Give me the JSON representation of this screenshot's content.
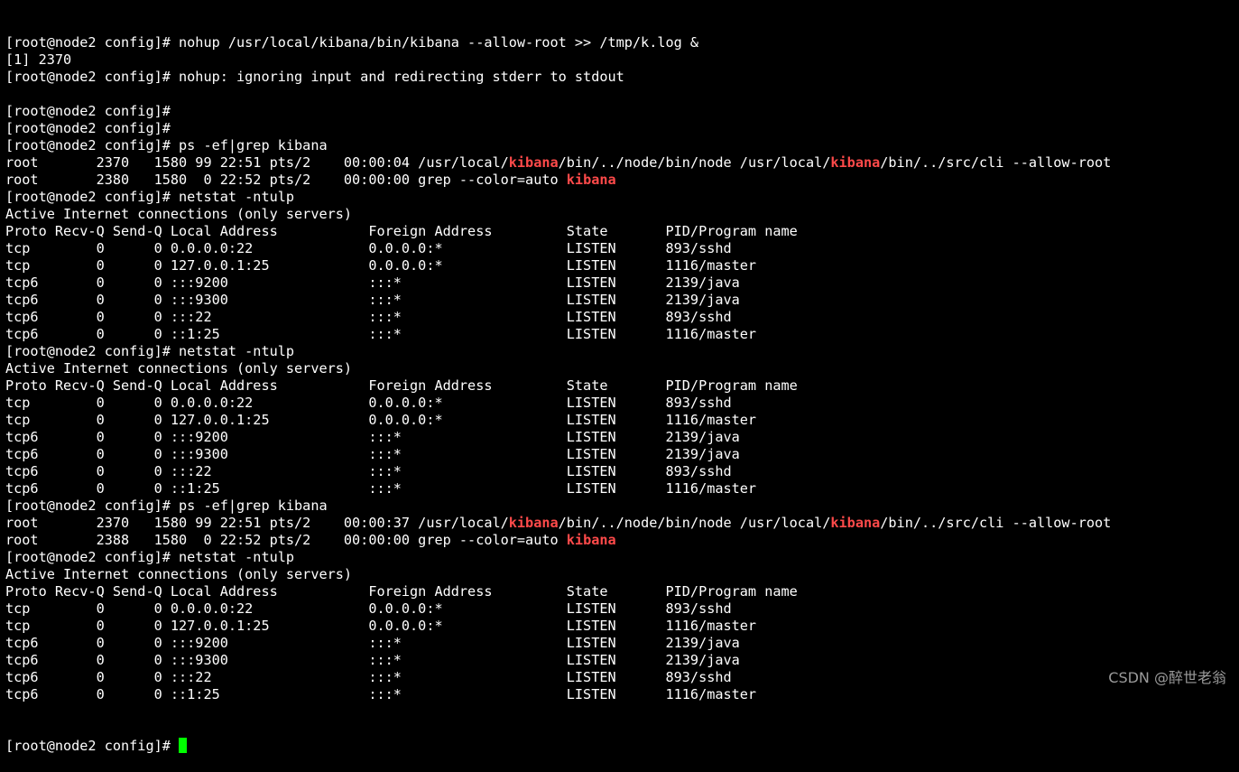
{
  "terminal": {
    "lines": [
      [
        {
          "t": "[root@node2 config]# nohup /usr/local/kibana/bin/kibana --allow-root >> /tmp/k.log &"
        }
      ],
      [
        {
          "t": "[1] 2370"
        }
      ],
      [
        {
          "t": "[root@node2 config]# nohup: ignoring input and redirecting stderr to stdout"
        }
      ],
      [
        {
          "t": ""
        }
      ],
      [
        {
          "t": "[root@node2 config]#"
        }
      ],
      [
        {
          "t": "[root@node2 config]#"
        }
      ],
      [
        {
          "t": "[root@node2 config]# ps -ef|grep kibana"
        }
      ],
      [
        {
          "t": "root       2370   1580 99 22:51 pts/2    00:00:04 /usr/local/"
        },
        {
          "t": "kibana",
          "hl": true
        },
        {
          "t": "/bin/../node/bin/node /usr/local/"
        },
        {
          "t": "kibana",
          "hl": true
        },
        {
          "t": "/bin/../src/cli --allow-root"
        }
      ],
      [
        {
          "t": "root       2380   1580  0 22:52 pts/2    00:00:00 grep --color=auto "
        },
        {
          "t": "kibana",
          "hl": true
        }
      ],
      [
        {
          "t": "[root@node2 config]# netstat -ntulp"
        }
      ],
      [
        {
          "t": "Active Internet connections (only servers)"
        }
      ],
      [
        {
          "t": "Proto Recv-Q Send-Q Local Address           Foreign Address         State       PID/Program name"
        }
      ],
      [
        {
          "t": "tcp        0      0 0.0.0.0:22              0.0.0.0:*               LISTEN      893/sshd"
        }
      ],
      [
        {
          "t": "tcp        0      0 127.0.0.1:25            0.0.0.0:*               LISTEN      1116/master"
        }
      ],
      [
        {
          "t": "tcp6       0      0 :::9200                 :::*                    LISTEN      2139/java"
        }
      ],
      [
        {
          "t": "tcp6       0      0 :::9300                 :::*                    LISTEN      2139/java"
        }
      ],
      [
        {
          "t": "tcp6       0      0 :::22                   :::*                    LISTEN      893/sshd"
        }
      ],
      [
        {
          "t": "tcp6       0      0 ::1:25                  :::*                    LISTEN      1116/master"
        }
      ],
      [
        {
          "t": "[root@node2 config]# netstat -ntulp"
        }
      ],
      [
        {
          "t": "Active Internet connections (only servers)"
        }
      ],
      [
        {
          "t": "Proto Recv-Q Send-Q Local Address           Foreign Address         State       PID/Program name"
        }
      ],
      [
        {
          "t": "tcp        0      0 0.0.0.0:22              0.0.0.0:*               LISTEN      893/sshd"
        }
      ],
      [
        {
          "t": "tcp        0      0 127.0.0.1:25            0.0.0.0:*               LISTEN      1116/master"
        }
      ],
      [
        {
          "t": "tcp6       0      0 :::9200                 :::*                    LISTEN      2139/java"
        }
      ],
      [
        {
          "t": "tcp6       0      0 :::9300                 :::*                    LISTEN      2139/java"
        }
      ],
      [
        {
          "t": "tcp6       0      0 :::22                   :::*                    LISTEN      893/sshd"
        }
      ],
      [
        {
          "t": "tcp6       0      0 ::1:25                  :::*                    LISTEN      1116/master"
        }
      ],
      [
        {
          "t": "[root@node2 config]# ps -ef|grep kibana"
        }
      ],
      [
        {
          "t": "root       2370   1580 99 22:51 pts/2    00:00:37 /usr/local/"
        },
        {
          "t": "kibana",
          "hl": true
        },
        {
          "t": "/bin/../node/bin/node /usr/local/"
        },
        {
          "t": "kibana",
          "hl": true
        },
        {
          "t": "/bin/../src/cli --allow-root"
        }
      ],
      [
        {
          "t": "root       2388   1580  0 22:52 pts/2    00:00:00 grep --color=auto "
        },
        {
          "t": "kibana",
          "hl": true
        }
      ],
      [
        {
          "t": "[root@node2 config]# netstat -ntulp"
        }
      ],
      [
        {
          "t": "Active Internet connections (only servers)"
        }
      ],
      [
        {
          "t": "Proto Recv-Q Send-Q Local Address           Foreign Address         State       PID/Program name"
        }
      ],
      [
        {
          "t": "tcp        0      0 0.0.0.0:22              0.0.0.0:*               LISTEN      893/sshd"
        }
      ],
      [
        {
          "t": "tcp        0      0 127.0.0.1:25            0.0.0.0:*               LISTEN      1116/master"
        }
      ],
      [
        {
          "t": "tcp6       0      0 :::9200                 :::*                    LISTEN      2139/java"
        }
      ],
      [
        {
          "t": "tcp6       0      0 :::9300                 :::*                    LISTEN      2139/java"
        }
      ],
      [
        {
          "t": "tcp6       0      0 :::22                   :::*                    LISTEN      893/sshd"
        }
      ],
      [
        {
          "t": "tcp6       0      0 ::1:25                  :::*                    LISTEN      1116/master"
        }
      ]
    ],
    "prompt": "[root@node2 config]# ",
    "highlight_color": "#ff4a4a",
    "cursor_color": "#00ff00",
    "background_color": "#000000",
    "text_color": "#ffffff"
  },
  "watermark": "CSDN @醉世老翁"
}
